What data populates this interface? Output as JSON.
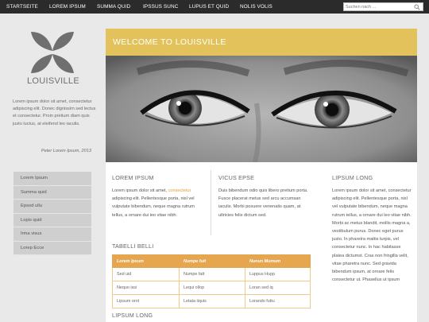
{
  "nav": {
    "items": [
      "STARTSEITE",
      "LOREM IPSUM",
      "SUMMA QUID",
      "IPSSUS SUNC",
      "LUPUS ET QUID",
      "NOLIS VOLIS"
    ]
  },
  "search": {
    "placeholder": "Suchen nach ..."
  },
  "sidebar": {
    "site_name": "LOUISVILLE",
    "quote": "Lorem ipsum dolor sit amet, consectetur adipiscing elit. Donec dignissim sed lectus et consectetur. Proin pretium diam quis justo luctus, at eleifend leo iaculis.",
    "quote_author": "Peter Lorem Ipsum, 2013",
    "menu": [
      "Lorem Ipsum",
      "Summa quid",
      "Epsod ullu",
      "Lopis quid",
      "Irma visus",
      "Lorep Ecce"
    ]
  },
  "banner": {
    "title": "WELCOME TO LOUISVILLE"
  },
  "main": {
    "col1": {
      "heading": "LOREM IPSUM",
      "text_before": "Lorem ipsum dolor sit amet, ",
      "link": "consectetur",
      "text_after": " adipiscing elit. Pellentesque porta, nisl vel vulputate bibendum, neque magna rutrum tellus, a ornare dui leo vitae nibh."
    },
    "col2": {
      "heading": "VICUS EPSE",
      "text": "Duis bibendum odio quis libero pretium porta. Fusce placerat metus sed arcu accumsan iaculis. Morbi posuere venenatis quam, at ultricies felis dictum sed."
    },
    "col3": {
      "heading": "LIPSUM LONG",
      "text": "Lorem ipsum dolor sit amet, consectetur adipiscing elit. Pellentesque porta, nisl vel vulputate bibendum, neque magna rutrum tellus, a ornare dui leo vitae nibh. Morbi ac metus blandit, mollis magna a, vestibulum purus. Donec eget purus justo. In pharetra mattis turpis, vel consectetur nunc. In hac habitasse platea dictumst. Cras non fringilla velit, vitae pharetra nunc. Sed gravida bibendum ipsum, at ornare felis consectetur ut. Phasellus ut ipsum"
    },
    "table": {
      "heading": "TABELLI BELLI",
      "columns": [
        "Lorem Ipsum",
        "Numpe fuit",
        "Nunun Mumum"
      ],
      "rows": [
        [
          "Sed uid",
          "Numpe fatt",
          "Luppus Hupp"
        ],
        [
          "Nequo issi",
          "Lequi ollop",
          "Loran sed iq"
        ],
        [
          "Lipsum orot",
          "Letata iiquis",
          "Lorando futtu"
        ]
      ]
    },
    "bottom_heading": "LIPSUM LONG"
  }
}
